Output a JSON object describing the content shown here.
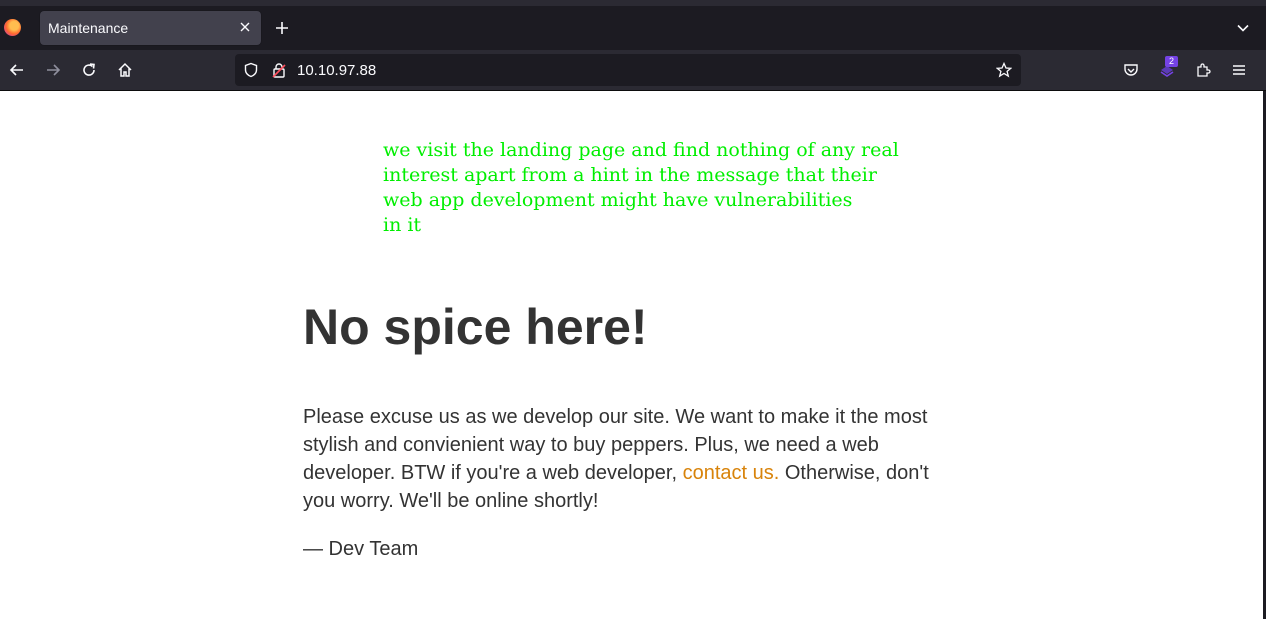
{
  "browser": {
    "tab": {
      "title": "Maintenance"
    },
    "url": "10.10.97.88",
    "extension_badge": "2",
    "icons": [
      "firefox-logo",
      "close-icon",
      "plus-icon",
      "chevron-down-icon",
      "back-arrow-icon",
      "forward-arrow-icon",
      "reload-icon",
      "home-icon",
      "shield-icon",
      "lock-warning-icon",
      "star-icon",
      "pocket-icon",
      "extension-icon",
      "puzzle-icon",
      "menu-icon"
    ]
  },
  "annotation": {
    "lines": [
      "we visit the landing page and find nothing of any real",
      "interest apart from a hint in the message that their",
      "web app development might have vulnerabilities",
      "in it"
    ],
    "color": "#00ee00"
  },
  "page": {
    "heading": "No spice here!",
    "paragraph_before_link": "Please excuse us as we develop our site. We want to make it the most stylish and convienient way to buy peppers. Plus, we need a web developer. BTW if you're a web developer, ",
    "link_text": "contact us.",
    "paragraph_after_link": " Otherwise, don't you worry. We'll be online shortly!",
    "signature": "— Dev Team",
    "link_color": "#d8830a"
  }
}
